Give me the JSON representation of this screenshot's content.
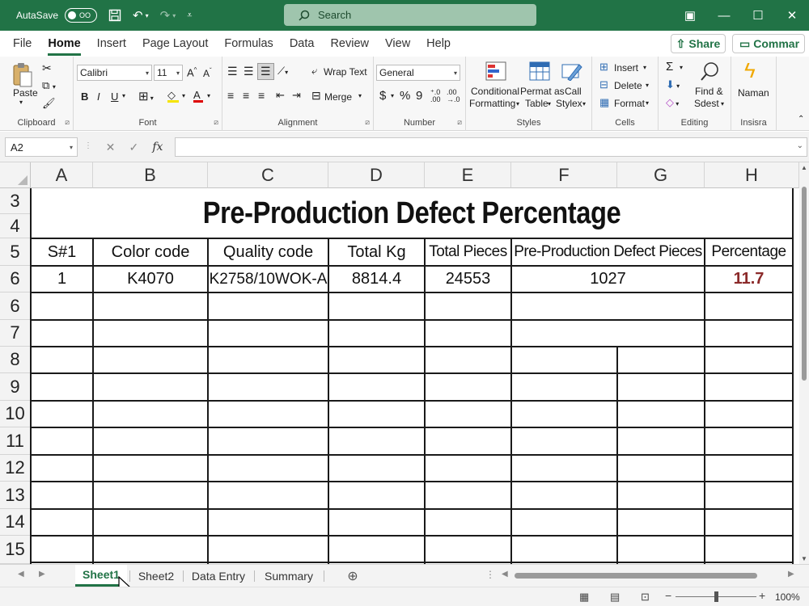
{
  "titlebar": {
    "autosave_label": "AutaSave",
    "autosave_state": "OO",
    "search_placeholder": "Search"
  },
  "ribbon_tabs": [
    "File",
    "Home",
    "Insert",
    "Page Layout",
    "Formulas",
    "Data",
    "Review",
    "View",
    "Help"
  ],
  "active_tab": "Home",
  "share_label": "Share",
  "comment_label": "Commar",
  "ribbon": {
    "clipboard": {
      "paste": "Paste",
      "label": "Clipboard"
    },
    "font": {
      "name": "Calibri",
      "size": "11",
      "label": "Font",
      "bold": "B",
      "italic": "I",
      "underline": "U"
    },
    "alignment": {
      "wrap_text": "Wrap Text",
      "merge": "Merge",
      "label": "Alignment"
    },
    "number": {
      "format": "General",
      "currency": "$",
      "percent": "%",
      "comma": "9",
      "label": "Number"
    },
    "styles": {
      "conditional_1": "Conditional",
      "conditional_2": "Formatting",
      "format_table_1": "Permat as",
      "format_table_2": "Table",
      "cell_styles_1": "Call",
      "cell_styles_2": "Stylex",
      "label": "Styles"
    },
    "cells": {
      "insert": "Insert",
      "delete": "Delete",
      "format": "Format",
      "label": "Cells"
    },
    "editing": {
      "sum": "Σ",
      "find_1": "Find &",
      "find_2": "Sdest",
      "label": "Editing"
    },
    "insights": {
      "name": "Naman",
      "label": "Insisra"
    }
  },
  "formula_bar": {
    "name_box": "A2",
    "fx": "fx",
    "value": ""
  },
  "columns": [
    "A",
    "B",
    "C",
    "D",
    "E",
    "F",
    "G",
    "H"
  ],
  "rows": [
    "3",
    "4",
    "5",
    "6",
    "6",
    "7",
    "8",
    "9",
    "10",
    "11",
    "12",
    "13",
    "14",
    "15"
  ],
  "sheet": {
    "title": "Pre-Production Defect Percentage",
    "headers": [
      "S#1",
      "Color code",
      "Quality code",
      "Total Kg",
      "Total Pieces",
      "Pre-Production Defect Pieces",
      "Percentage"
    ],
    "data_row": [
      "1",
      "K4070",
      "K2758/10WOK-A",
      "8814.4",
      "24553",
      "1027",
      "11.7"
    ],
    "highlight_color": "#8b2a2a"
  },
  "sheet_tabs": [
    "Sheet1",
    "Sheet2",
    "Data Entry",
    "Summary"
  ],
  "active_sheet": "Sheet1",
  "zoom": "100%",
  "colors": {
    "excel_green": "#217346"
  }
}
